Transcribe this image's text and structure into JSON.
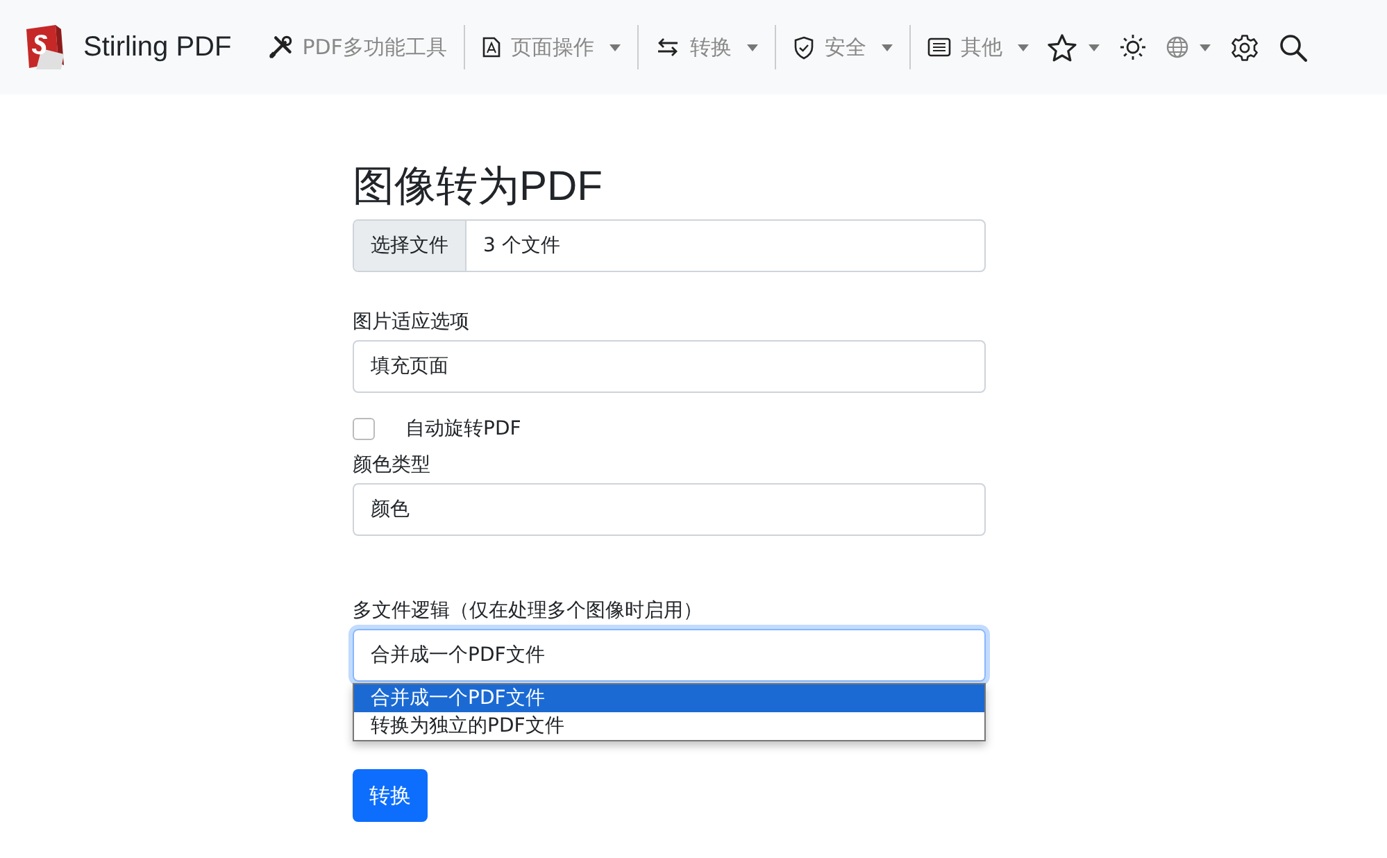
{
  "navbar": {
    "brand": "Stirling PDF",
    "items": [
      {
        "label": "PDF多功能工具",
        "dropdown": false,
        "separated": true
      },
      {
        "label": "页面操作",
        "dropdown": true,
        "separated": true
      },
      {
        "label": "转换",
        "dropdown": true,
        "separated": true
      },
      {
        "label": "安全",
        "dropdown": true,
        "separated": true
      },
      {
        "label": "其他",
        "dropdown": true,
        "separated": false
      }
    ],
    "icon_buttons": [
      {
        "dropdown": true
      },
      {
        "dropdown": false
      },
      {
        "dropdown": true
      },
      {
        "dropdown": false
      },
      {
        "dropdown": false
      }
    ]
  },
  "form": {
    "title": "图像转为PDF",
    "fields": [
      {
        "kind": "file",
        "button": "选择文件",
        "value": "3 个文件"
      },
      {
        "kind": "select",
        "label": "图片适应选项",
        "value": "填充页面"
      },
      {
        "kind": "checkbox",
        "label": "自动旋转PDF",
        "checked": false
      },
      {
        "kind": "select",
        "label": "颜色类型",
        "value": "颜色"
      },
      {
        "kind": "select",
        "label": "多文件逻辑（仅在处理多个图像时启用）",
        "value": "合并成一个PDF文件",
        "focused": true,
        "options": [
          {
            "label": "合并成一个PDF文件",
            "selected": true
          },
          {
            "label": "转换为独立的PDF文件",
            "selected": false
          }
        ]
      }
    ],
    "submit": "转换"
  }
}
